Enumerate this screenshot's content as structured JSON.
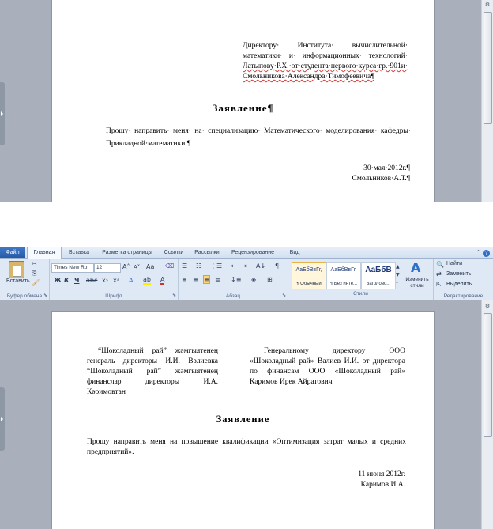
{
  "top_doc": {
    "address_lines": [
      "Директору· Института· вычислительной·",
      "математики· и· информационных· технологий·",
      "Латыпову·Р.Х.·от·студента·первого·курса·гр.·901и·",
      "Смольникова·Александра·Тимофеевича¶"
    ],
    "title": "Заявление¶",
    "body_line1": "Прошу· направить· меня· на· специализацию· Математического· моделирования· кафедры·",
    "body_line2": "Прикладной·математики.¶",
    "date": "30·мая·2012г.¶",
    "signature": "Смольников·А.Т.¶"
  },
  "ribbon": {
    "tabs": [
      "Файл",
      "Главная",
      "Вставка",
      "Разметка страницы",
      "Ссылки",
      "Рассылки",
      "Рецензирование",
      "Вид"
    ],
    "active_tab": "Главная",
    "groups": {
      "clipboard": "Буфер обмена",
      "font": "Шрифт",
      "paragraph": "Абзац",
      "styles": "Стили",
      "editing": "Редактирование"
    },
    "paste_label": "Вставить",
    "font_name": "Times New Ro",
    "font_size": "12",
    "styles": [
      {
        "sample": "АаБбВвГг,",
        "name": "¶ Обычный"
      },
      {
        "sample": "АаБбВвГг,",
        "name": "¶ Без инте..."
      },
      {
        "sample": "АаБбВ",
        "name": "Заголово..."
      }
    ],
    "change_styles": "Изменить стили",
    "find": "Найти",
    "replace": "Заменить",
    "select": "Выделить"
  },
  "bottom_doc": {
    "left_block": [
      "“Шоколадный рай” жәмгыятенең",
      "генераль директоры И.И. Вәлиевка",
      "“Шоколадный рай” жәмгыятенең",
      "финанслар директоры И.А.",
      "Кәримовтан"
    ],
    "right_block": [
      "Генеральному директору ООО",
      "«Шоколадный рай» Валиев И.И. от директора",
      "по финансам ООО «Шоколадный рай»",
      "Каримов Ирек Айратович"
    ],
    "title": "Заявление",
    "body_line1": "Прошу направить меня на повышение квалификации «Оптимизация затрат малых и средних",
    "body_line2": "предприятий».",
    "date": "11 июня 2012г.",
    "signature": "Каримов И.А."
  }
}
